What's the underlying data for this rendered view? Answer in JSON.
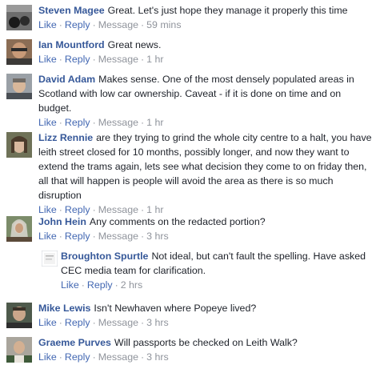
{
  "comments": [
    {
      "author": "Steven Magee",
      "text": "Great. Let's just hope they manage it properly this time",
      "like": "Like",
      "reply": "Reply",
      "message": "Message",
      "time": "59 mins"
    },
    {
      "author": "Ian Mountford",
      "text": "Great news.",
      "like": "Like",
      "reply": "Reply",
      "message": "Message",
      "time": "1 hr"
    },
    {
      "author": "David Adam",
      "text": "Makes sense. One of the most densely populated areas in Scotland with low car ownership. Caveat - if it is done on time and on budget.",
      "like": "Like",
      "reply": "Reply",
      "message": "Message",
      "time": "1 hr"
    },
    {
      "author": "Lizz Rennie",
      "text": "are they trying to grind the whole city centre to a halt, you have leith street closed for 10 months, possibly longer, and now they want to extend the trams again, lets see what decision they come to on friday then, all that will happen is people will avoid the area as there is so much disruption",
      "like": "Like",
      "reply": "Reply",
      "message": "Message",
      "time": "1 hr"
    },
    {
      "author": "John Hein",
      "text": "Any comments on the redacted portion?",
      "like": "Like",
      "reply": "Reply",
      "message": "Message",
      "time": "3 hrs"
    },
    {
      "author": "Broughton Spurtle",
      "text": "Not ideal, but can't fault the spelling. Have asked CEC media team for clarification.",
      "like": "Like",
      "reply": "Reply",
      "time": "2 hrs"
    },
    {
      "author": "Mike Lewis",
      "text": "Isn't Newhaven where Popeye lived?",
      "like": "Like",
      "reply": "Reply",
      "message": "Message",
      "time": "3 hrs"
    },
    {
      "author": "Graeme Purves",
      "text": "Will passports be checked on Leith Walk?",
      "like": "Like",
      "reply": "Reply",
      "message": "Message",
      "time": "3 hrs"
    }
  ],
  "sep": "·"
}
